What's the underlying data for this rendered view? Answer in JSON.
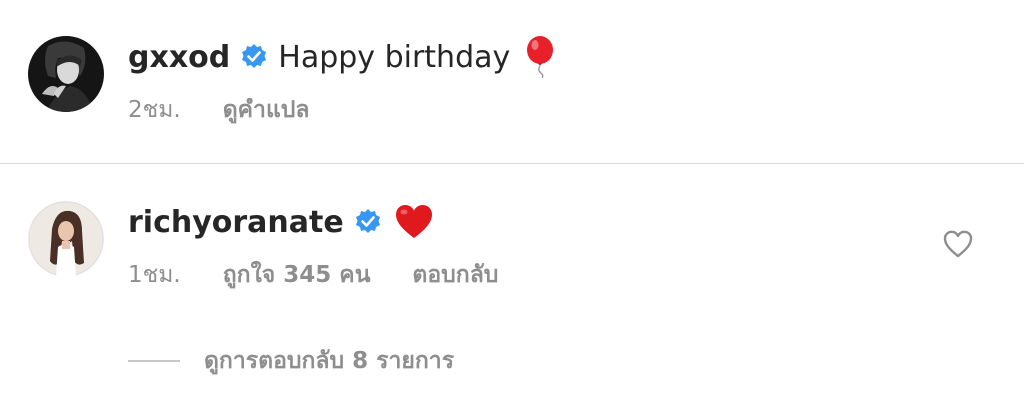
{
  "comments": [
    {
      "username": "gxxod",
      "verified": true,
      "text": "Happy birthday",
      "emoji": "balloon",
      "time": "2ชม.",
      "translate_label": "ดูคำแปล"
    },
    {
      "username": "richyoranate",
      "verified": true,
      "text": "",
      "emoji": "red-heart",
      "time": "1ชม.",
      "likes_label": "ถูกใจ 345 คน",
      "reply_label": "ตอบกลับ",
      "view_replies_label": "ดูการตอบกลับ 8 รายการ"
    }
  ],
  "colors": {
    "verified_blue": "#3897f0",
    "meta_gray": "#8e8e8e",
    "text": "#262626",
    "divider": "#dbdbdb",
    "balloon_red": "#e8202a",
    "heart_red": "#e0191e"
  }
}
